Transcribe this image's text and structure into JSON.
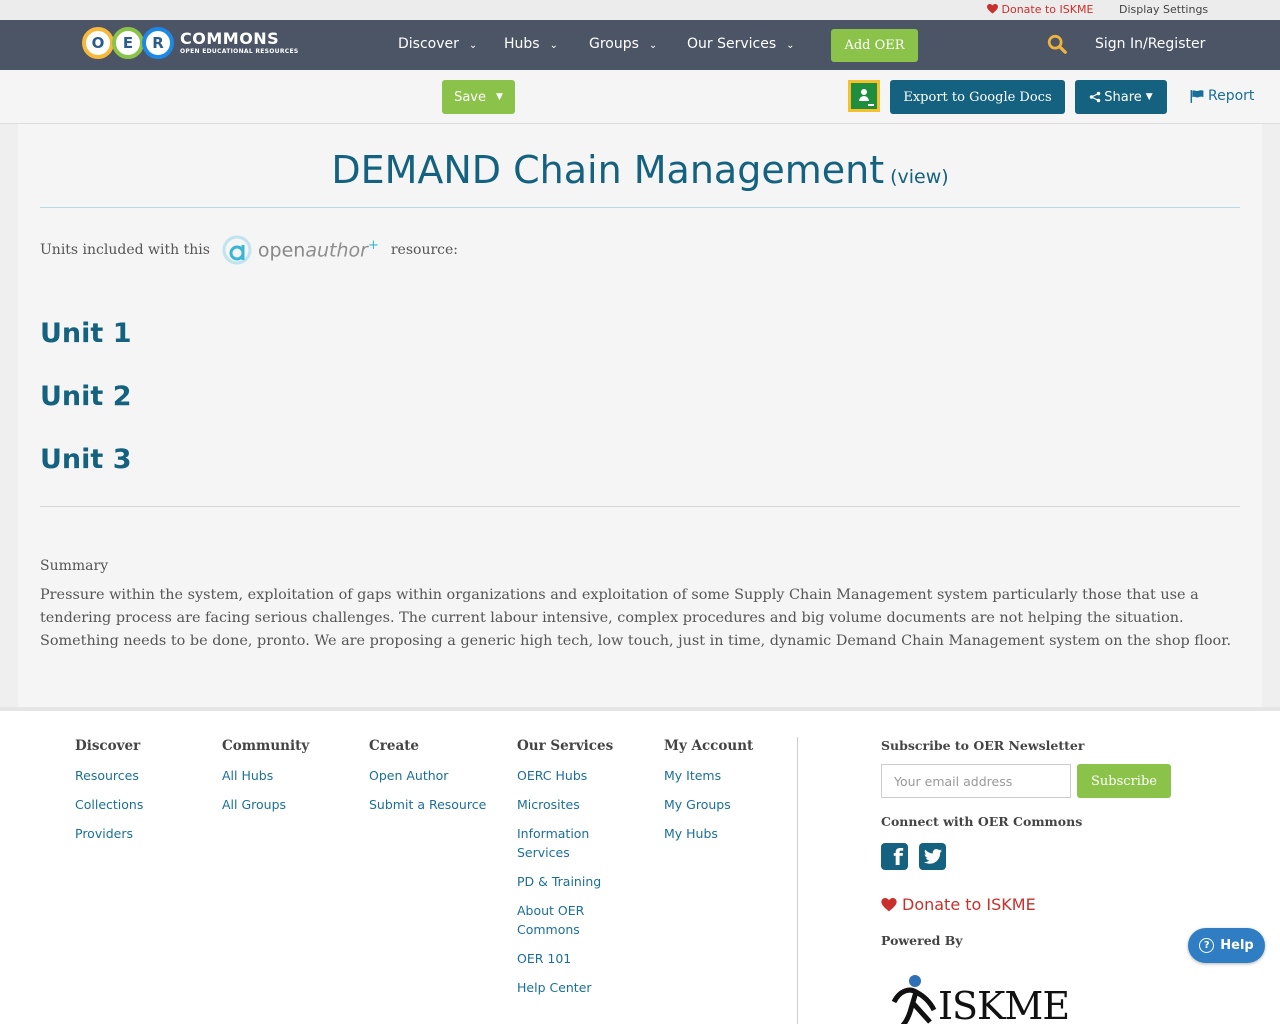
{
  "utility": {
    "donate": "Donate to ISKME",
    "display_settings": "Display Settings"
  },
  "nav": {
    "logo_letters": [
      "O",
      "E",
      "R"
    ],
    "logo_word": "COMMONS",
    "logo_sub": "OPEN EDUCATIONAL RESOURCES",
    "items": [
      {
        "label": "Discover"
      },
      {
        "label": "Hubs"
      },
      {
        "label": "Groups"
      },
      {
        "label": "Our Services"
      }
    ],
    "add_oer": "Add OER",
    "signin": "Sign In/Register"
  },
  "actions": {
    "save": "Save",
    "export": "Export to Google Docs",
    "share": "Share",
    "report": "Report"
  },
  "resource": {
    "title": "DEMAND Chain Management",
    "view_link": "(view)",
    "units_prefix": "Units included with this",
    "units_suffix": "resource:",
    "openauthor_logo": {
      "open": "open",
      "author": "author"
    },
    "units": [
      "Unit 1",
      "Unit 2",
      "Unit 3"
    ],
    "summary_heading": "Summary",
    "summary_text": "Pressure within the system, exploitation of gaps within organizations and exploitation of some Supply Chain Management system particularly those that use a tendering process are facing serious challenges. The current labour intensive, complex procedures and big volume documents are not helping the situation. Something needs to be done, pronto. We are proposing a generic high tech, low touch, just in time, dynamic Demand Chain Management system on the shop floor."
  },
  "footer": {
    "columns": [
      {
        "heading": "Discover",
        "links": [
          "Resources",
          "Collections",
          "Providers"
        ]
      },
      {
        "heading": "Community",
        "links": [
          "All Hubs",
          "All Groups"
        ]
      },
      {
        "heading": "Create",
        "links": [
          "Open Author",
          "Submit a Resource"
        ]
      },
      {
        "heading": "Our Services",
        "links": [
          "OERC Hubs",
          "Microsites",
          "Information Services",
          "PD & Training",
          "About OER Commons",
          "OER 101",
          "Help Center"
        ]
      },
      {
        "heading": "My Account",
        "links": [
          "My Items",
          "My Groups",
          "My Hubs"
        ]
      }
    ],
    "newsletter_heading": "Subscribe to OER Newsletter",
    "email_placeholder": "Your email address",
    "subscribe": "Subscribe",
    "connect_heading": "Connect with OER Commons",
    "donate": "Donate to ISKME",
    "powered_heading": "Powered By",
    "iskme_logo_text": "ISKME"
  },
  "help": {
    "label": "Help"
  },
  "colors": {
    "nav_bg": "#4c5566",
    "brand_teal": "#14627f",
    "accent_green": "#8bc34a",
    "donate_red": "#c9302c",
    "search_gold": "#f0b43c"
  }
}
